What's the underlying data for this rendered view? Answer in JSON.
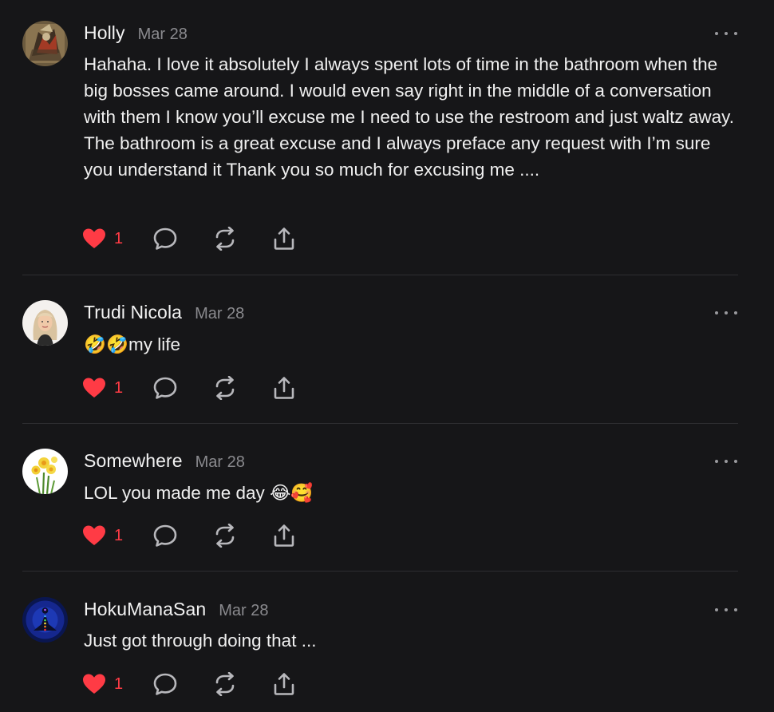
{
  "comments": [
    {
      "author": "Holly",
      "date": "Mar 28",
      "text": "Hahaha. I love it absolutely I always spent lots of time in the bathroom when the big bosses came around. I would even say right in the middle of a conversation with them I know you’ll excuse me I need to use the restroom and just waltz away. The bathroom is a great excuse and I always preface any request with I’m sure you understand it Thank you so much for excusing me ....",
      "likes": "1"
    },
    {
      "author": "Trudi Nicola",
      "date": "Mar 28",
      "text": "🤣🤣my life",
      "likes": "1"
    },
    {
      "author": "Somewhere",
      "date": "Mar 28",
      "text": "LOL you made me day 😂🥰",
      "likes": "1"
    },
    {
      "author": "HokuManaSan",
      "date": "Mar 28",
      "text": "Just got through doing that ...",
      "likes": "1"
    }
  ],
  "icons": {
    "like": "heart-icon",
    "reply": "comment-bubble-icon",
    "restack": "restack-icon",
    "share": "share-icon",
    "more": "more-options-icon"
  },
  "colors": {
    "background": "#161618",
    "like": "#ff3b45",
    "meta": "#8a8a8e"
  }
}
